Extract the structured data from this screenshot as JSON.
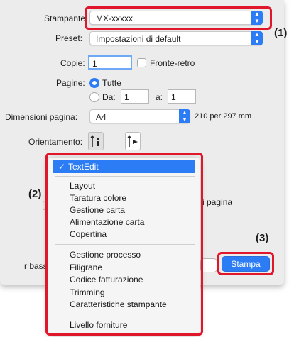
{
  "printer": {
    "label": "Stampante",
    "value": "MX-xxxxx"
  },
  "preset": {
    "label": "Preset:",
    "value": "Impostazioni di default"
  },
  "copies": {
    "label": "Copie:",
    "value": "1",
    "duplex_label": "Fronte-retro"
  },
  "pages": {
    "label": "Pagine:",
    "all_label": "Tutte",
    "from_label": "Da:",
    "from_value": "1",
    "to_label": "a:",
    "to_value": "1"
  },
  "paper_size": {
    "label": "Dimensioni pagina:",
    "value": "A4",
    "dims": "210 per 297 mm"
  },
  "orientation": {
    "label": "Orientamento:"
  },
  "partial": {
    "pagina": "i pagina",
    "left_label": "r bass"
  },
  "buttons": {
    "print": "Stampa"
  },
  "callouts": {
    "c1": "(1)",
    "c2": "(2)",
    "c3": "(3)"
  },
  "menu": {
    "selected": "TextEdit",
    "group1": [
      "Layout",
      "Taratura colore",
      "Gestione carta",
      "Alimentazione carta",
      "Copertina"
    ],
    "group2": [
      "Gestione processo",
      "Filigrane",
      "Codice fatturazione",
      "Trimming",
      "Caratteristiche stampante"
    ],
    "group3": [
      "Livello forniture"
    ]
  },
  "colors": {
    "accent": "#2b7cf5",
    "highlight_box": "#e0162b",
    "dialog_bg": "#ececec"
  }
}
